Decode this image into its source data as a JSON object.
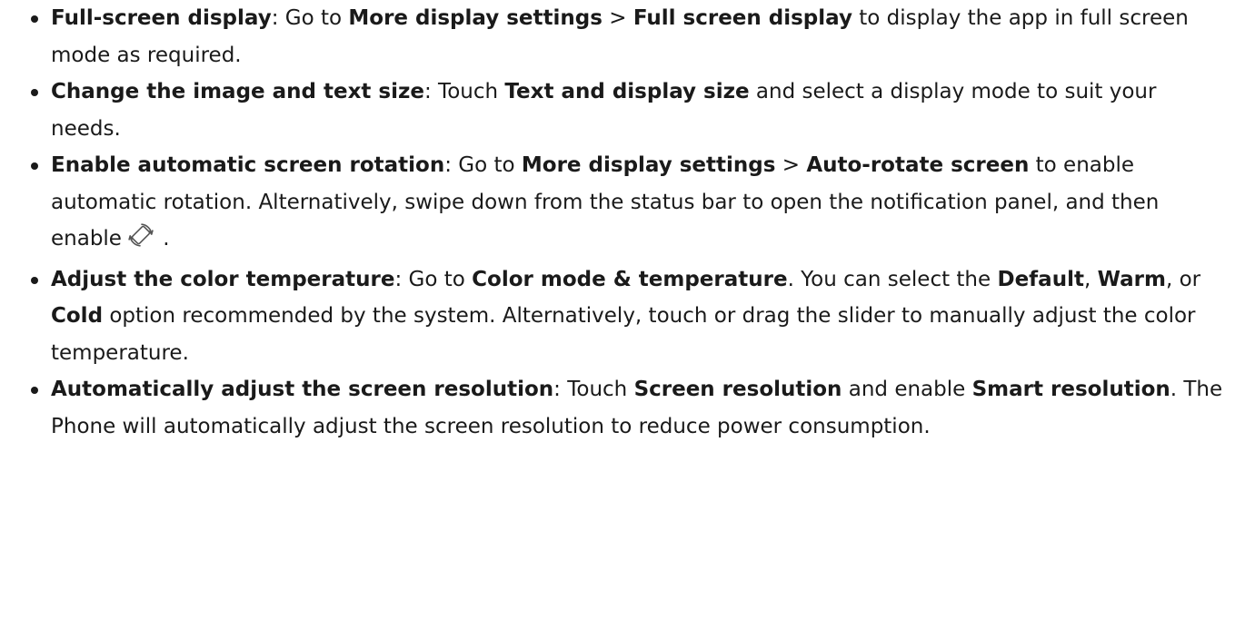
{
  "items": [
    {
      "title": "Full-screen display",
      "t1": ": Go to ",
      "b1": "More display settings",
      "t2": " > ",
      "b2": "Full screen display",
      "t3": " to display the app in full screen mode as required."
    },
    {
      "title": "Change the image and text size",
      "t1": ": Touch ",
      "b1": "Text and display size",
      "t2": " and select a display mode to suit your needs."
    },
    {
      "title": "Enable automatic screen rotation",
      "t1": ": Go to ",
      "b1": "More display settings",
      "t2": " > ",
      "b2": "Auto-rotate screen",
      "t3": " to enable automatic rotation. Alternatively, swipe down from the status bar to open the notification panel, and then enable",
      "t4": " .",
      "icon": "auto-rotate-icon"
    },
    {
      "title": "Adjust the color temperature",
      "t1": ": Go to ",
      "b1": "Color mode & temperature",
      "t2": ". You can select the ",
      "b2": "Default",
      "t3": ", ",
      "b3": "Warm",
      "t4": ", or ",
      "b4": "Cold",
      "t5": " option recommended by the system. Alternatively, touch or drag the slider to manually adjust the color temperature."
    },
    {
      "title": "Automatically adjust the screen resolution",
      "t1": ": Touch ",
      "b1": "Screen resolution",
      "t2": " and enable ",
      "b2": "Smart resolution",
      "t3": ". The Phone will automatically adjust the screen resolution to reduce power consumption."
    }
  ]
}
